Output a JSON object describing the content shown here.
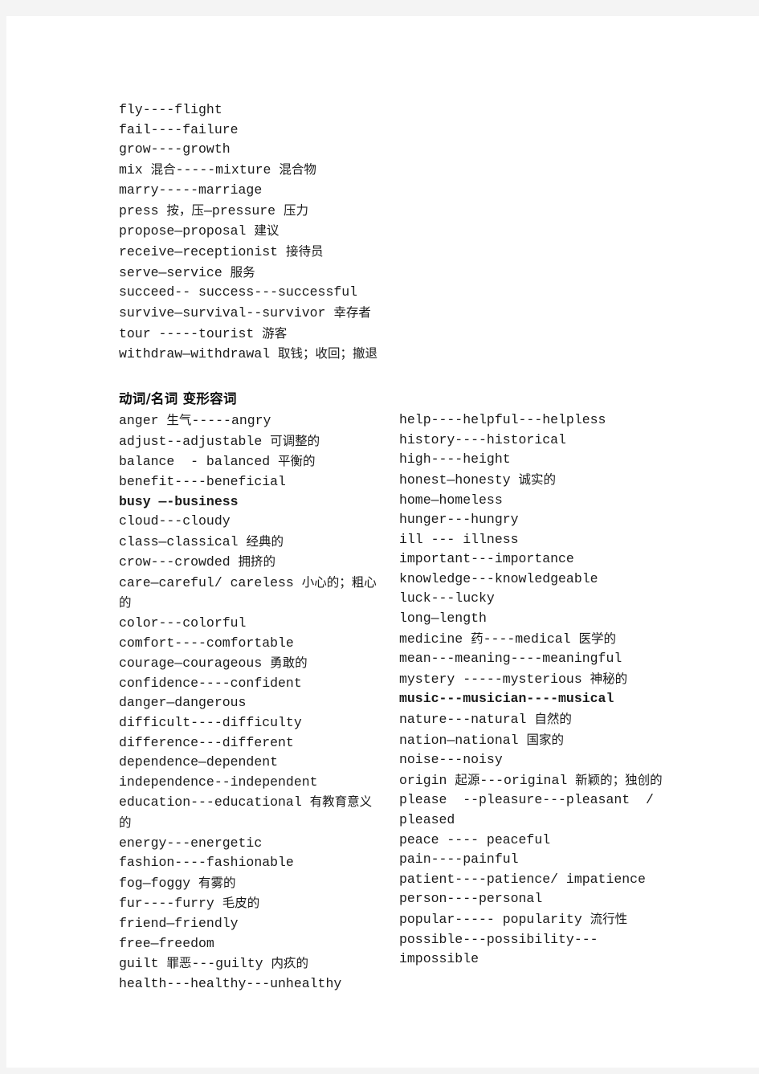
{
  "document": {
    "page_background": "#ffffff",
    "canvas_background": "#f4f4f4",
    "text_color": "#1a1a1a"
  },
  "section_one": {
    "name": "verb-to-noun-list",
    "lines": [
      "fly----flight",
      "fail----failure",
      "grow----growth",
      "mix 混合-----mixture 混合物",
      "marry-----marriage",
      "press 按，压—pressure 压力",
      "propose—proposal 建议",
      "receive—receptionist 接待员",
      "serve—service 服务",
      "succeed-- success---successful",
      "survive—survival--survivor 幸存者",
      "tour -----tourist 游客",
      "withdraw—withdrawal 取钱；收回；撤退"
    ]
  },
  "section_two": {
    "heading": "动词/名词 变形容词",
    "left_column": [
      {
        "text": "anger 生气-----angry",
        "bold": false
      },
      {
        "text": "adjust--adjustable 可调整的",
        "bold": false
      },
      {
        "text": "balance  - balanced 平衡的",
        "bold": false
      },
      {
        "text": "benefit----beneficial",
        "bold": false
      },
      {
        "text": "busy —-business",
        "bold": true
      },
      {
        "text": "cloud---cloudy",
        "bold": false
      },
      {
        "text": "class—classical 经典的",
        "bold": false
      },
      {
        "text": "crow---crowded 拥挤的",
        "bold": false
      },
      {
        "text": "care—careful/ careless 小心的；粗心的",
        "bold": false
      },
      {
        "text": "color---colorful",
        "bold": false
      },
      {
        "text": "comfort----comfortable",
        "bold": false
      },
      {
        "text": "courage—courageous 勇敢的",
        "bold": false
      },
      {
        "text": "confidence----confident",
        "bold": false
      },
      {
        "text": "danger—dangerous",
        "bold": false
      },
      {
        "text": "difficult----difficulty",
        "bold": false
      },
      {
        "text": "difference---different",
        "bold": false
      },
      {
        "text": "dependence—dependent",
        "bold": false
      },
      {
        "text": "independence--independent",
        "bold": false
      },
      {
        "text": "education---educational 有教育意义的",
        "bold": false
      },
      {
        "text": "energy---energetic",
        "bold": false
      },
      {
        "text": "fashion----fashionable",
        "bold": false
      },
      {
        "text": "fog—foggy 有雾的",
        "bold": false
      },
      {
        "text": "fur----furry 毛皮的",
        "bold": false
      },
      {
        "text": "friend—friendly",
        "bold": false
      },
      {
        "text": "free—freedom",
        "bold": false
      },
      {
        "text": "guilt 罪恶---guilty 内疚的",
        "bold": false
      },
      {
        "text": "health---healthy---unhealthy",
        "bold": false
      }
    ],
    "right_column": [
      {
        "text": "help----helpful---helpless",
        "bold": false
      },
      {
        "text": "history----historical",
        "bold": false
      },
      {
        "text": "high----height",
        "bold": false
      },
      {
        "text": "honest—honesty 诚实的",
        "bold": false
      },
      {
        "text": "home—homeless",
        "bold": false
      },
      {
        "text": "hunger---hungry",
        "bold": false
      },
      {
        "text": "ill --- illness",
        "bold": false
      },
      {
        "text": "important---importance",
        "bold": false
      },
      {
        "text": "knowledge---knowledgeable",
        "bold": false
      },
      {
        "text": "luck---lucky",
        "bold": false
      },
      {
        "text": "long—length",
        "bold": false
      },
      {
        "text": "medicine 药----medical 医学的",
        "bold": false
      },
      {
        "text": "mean---meaning----meaningful",
        "bold": false
      },
      {
        "text": "mystery -----mysterious 神秘的",
        "bold": false
      },
      {
        "text": "music---musician----musical",
        "bold": true
      },
      {
        "text": "nature---natural 自然的",
        "bold": false
      },
      {
        "text": "nation—national 国家的",
        "bold": false
      },
      {
        "text": "noise---noisy",
        "bold": false
      },
      {
        "text": "origin 起源---original 新颖的；独创的",
        "bold": false
      },
      {
        "text": "please  --pleasure---pleasant  / pleased",
        "bold": false
      },
      {
        "text": "peace ---- peaceful",
        "bold": false
      },
      {
        "text": "pain----painful",
        "bold": false
      },
      {
        "text": "patient----patience/ impatience",
        "bold": false
      },
      {
        "text": "person----personal",
        "bold": false
      },
      {
        "text": "popular----- popularity 流行性",
        "bold": false
      },
      {
        "text": "possible---possibility---impossible",
        "bold": false
      }
    ]
  }
}
